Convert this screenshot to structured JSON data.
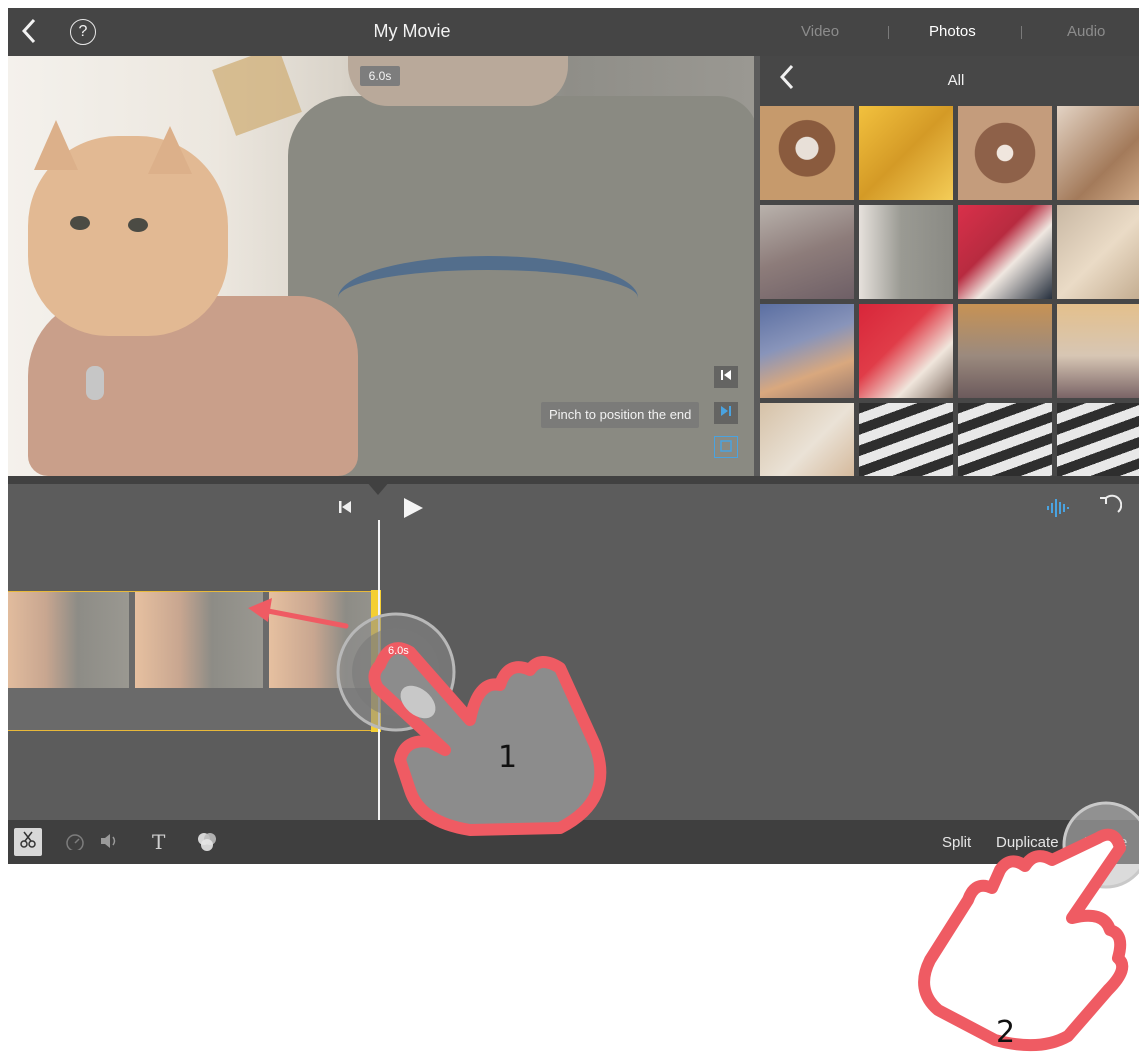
{
  "topbar": {
    "title": "My Movie",
    "back_icon": "chevron-left-icon",
    "help_label": "?",
    "tabs": [
      {
        "label": "Video",
        "active": false
      },
      {
        "label": "Photos",
        "active": true
      },
      {
        "label": "Audio",
        "active": false
      }
    ]
  },
  "viewer": {
    "duration_label": "6.0s",
    "pinch_tip": "Pinch to position the end",
    "controls": [
      "skip-to-start-icon",
      "skip-to-end-icon",
      "crop-icon"
    ]
  },
  "photos": {
    "title": "All",
    "back_icon": "chevron-left-icon"
  },
  "timeline": {
    "clip_duration": "6.0s",
    "icons": [
      "skip-start-icon",
      "play-icon",
      "audio-waveform-icon",
      "undo-icon"
    ]
  },
  "toolbar": {
    "tools": [
      "scissors-icon",
      "speed-icon",
      "volume-icon",
      "title-text-icon",
      "filters-icon"
    ],
    "title_tool_label": "T",
    "actions": {
      "split": "Split",
      "duplicate": "Duplicate",
      "delete": "Delete"
    }
  },
  "annotations": {
    "step1": "1",
    "step2": "2"
  },
  "colors": {
    "accent_blue": "#4aa3e0",
    "clip_handle": "#f5cf33",
    "hand_outline": "#ef5b63"
  }
}
